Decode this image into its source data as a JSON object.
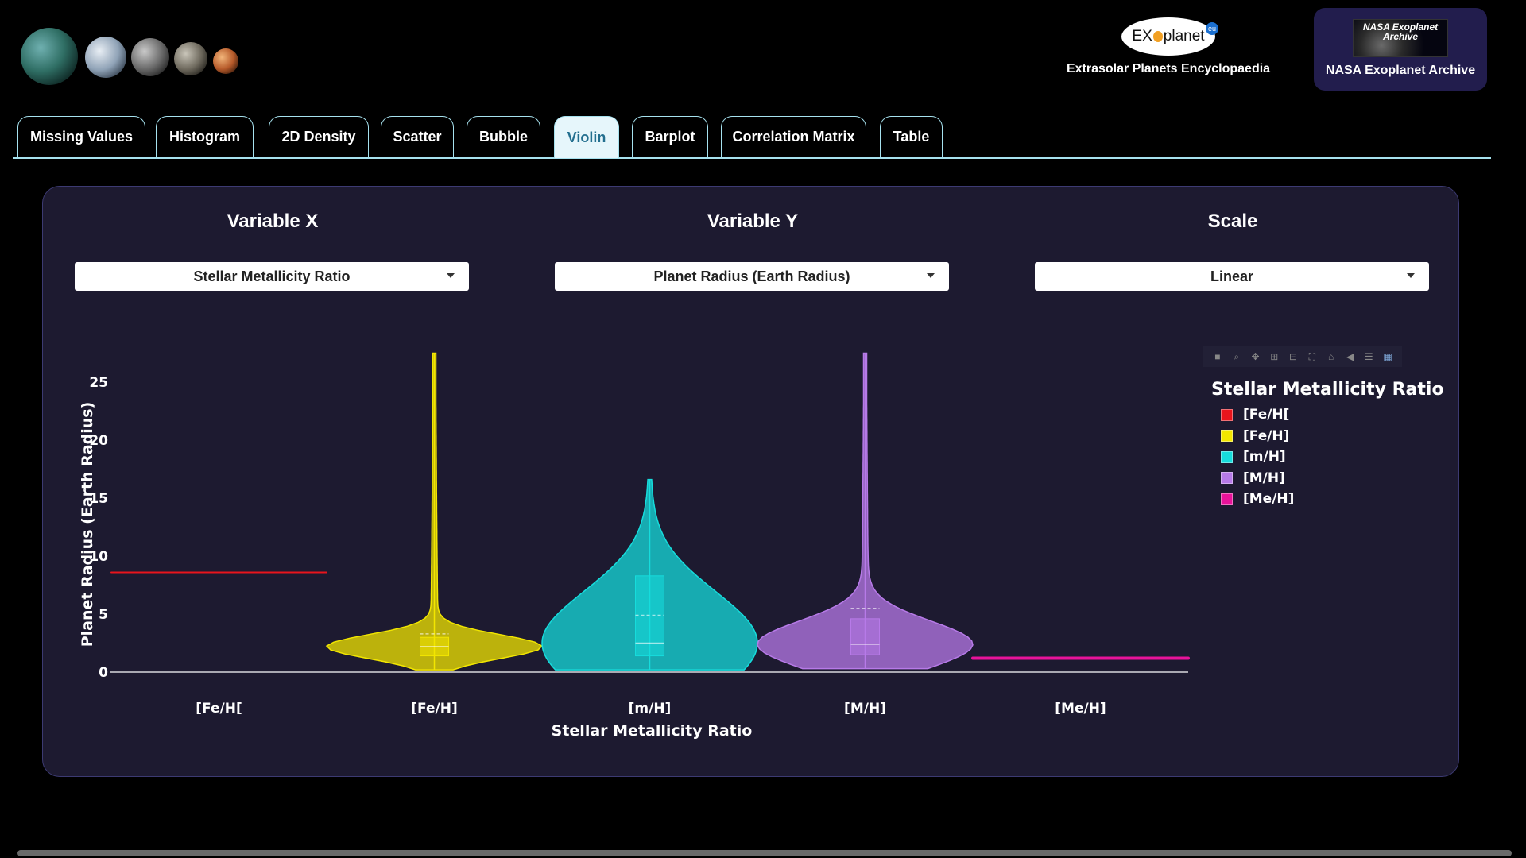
{
  "header": {
    "exoplanet_eu": {
      "logo_left": "EX",
      "logo_right": "planet",
      "logo_badge": "eu",
      "caption": "Extrasolar Planets Encyclopaedia"
    },
    "nasa": {
      "logo_text": "NASA Exoplanet Archive",
      "caption": "NASA Exoplanet Archive"
    }
  },
  "tabs": [
    {
      "label": "Missing Values"
    },
    {
      "label": "Histogram"
    },
    {
      "label": "2D Density"
    },
    {
      "label": "Scatter"
    },
    {
      "label": "Bubble"
    },
    {
      "label": "Violin",
      "active": true
    },
    {
      "label": "Barplot"
    },
    {
      "label": "Correlation Matrix"
    },
    {
      "label": "Table"
    }
  ],
  "controls": {
    "x": {
      "label": "Variable X",
      "value": "Stellar Metallicity Ratio"
    },
    "y": {
      "label": "Variable Y",
      "value": "Planet Radius (Earth Radius)"
    },
    "scale": {
      "label": "Scale",
      "value": "Linear"
    }
  },
  "modebar": [
    "camera-icon",
    "zoom-icon",
    "pan-icon",
    "zoom-in-icon",
    "zoom-out-icon",
    "autoscale-icon",
    "reset-axes-icon",
    "hover-closest-icon",
    "hover-compare-icon",
    "plotly-logo-icon"
  ],
  "chart_data": {
    "type": "violin",
    "title": "",
    "xlabel": "Stellar Metallicity Ratio",
    "ylabel": "Planet Radius (Earth Radius)",
    "ylim": [
      0,
      28
    ],
    "yticks": [
      0,
      5,
      10,
      15,
      20,
      25
    ],
    "categories": [
      "[Fe/H[",
      "[Fe/H]",
      "[m/H]",
      "[M/H]",
      "[Me/H]"
    ],
    "legend_title": "Stellar Metallicity Ratio",
    "legend_position": "right",
    "series": [
      {
        "name": "[Fe/H[",
        "color": "#e8141c",
        "min": 8.6,
        "max": 8.6,
        "q1": 8.6,
        "median": 8.6,
        "q3": 8.6,
        "mean": 8.6
      },
      {
        "name": "[Fe/H]",
        "color": "#f2e600",
        "min": 0.2,
        "max": 27.5,
        "q1": 1.4,
        "median": 2.2,
        "q3": 3.0,
        "mean": 3.3
      },
      {
        "name": "[m/H]",
        "color": "#16dcdc",
        "min": 0.2,
        "max": 16.6,
        "q1": 1.4,
        "median": 2.5,
        "q3": 8.3,
        "mean": 4.9
      },
      {
        "name": "[M/H]",
        "color": "#b77ae8",
        "min": 0.3,
        "max": 27.5,
        "q1": 1.5,
        "median": 2.4,
        "q3": 4.6,
        "mean": 5.5
      },
      {
        "name": "[Me/H]",
        "color": "#e8139a",
        "min": 1.2,
        "max": 1.2,
        "q1": 1.2,
        "median": 1.2,
        "q3": 1.2,
        "mean": 1.2
      }
    ]
  }
}
